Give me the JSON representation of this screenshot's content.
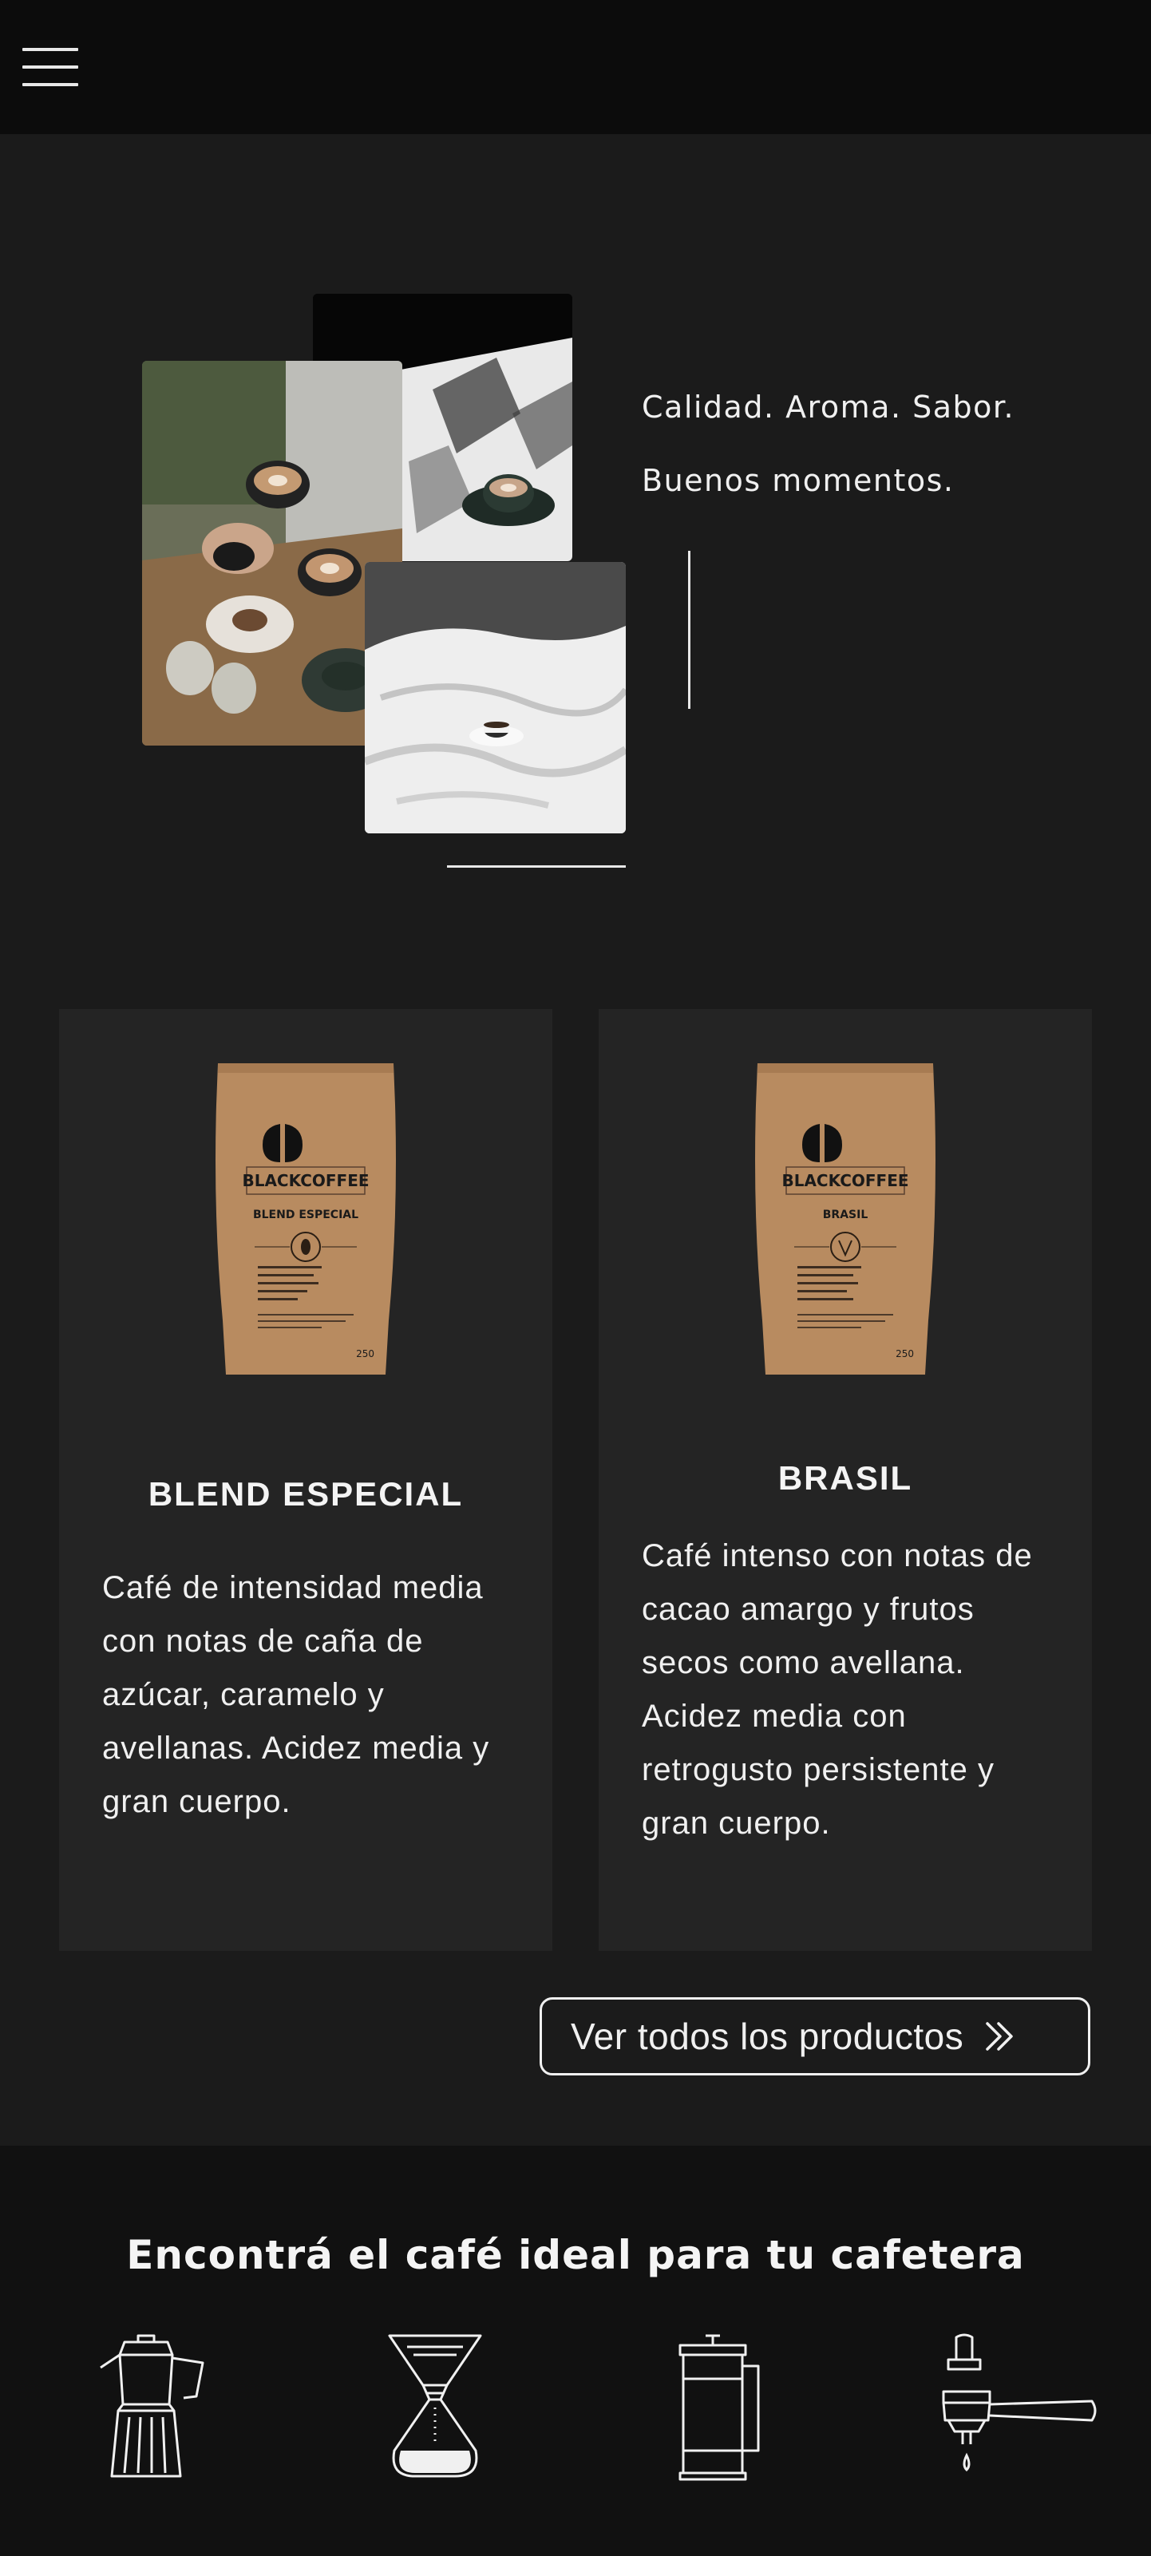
{
  "header": {
    "menu_icon": "hamburger-menu-icon"
  },
  "hero": {
    "tagline_1": "Calidad. Aroma. Sabor.",
    "tagline_2": "Buenos momentos."
  },
  "products": [
    {
      "brand": "BLACKCOFFEE",
      "bag_label": "BLEND ESPECIAL",
      "weight": "250",
      "title": "BLEND ESPECIAL",
      "description": "Café de intensidad media con notas de caña de azúcar, caramelo y avellanas. Acidez media y gran cuerpo."
    },
    {
      "brand": "BLACKCOFFEE",
      "bag_label": "BRASIL",
      "weight": "250",
      "title": "BRASIL",
      "description": "Café intenso con notas de cacao amargo y frutos secos como avellana. Acidez media con retrogusto persistente y gran cuerpo."
    }
  ],
  "cta": {
    "label": "Ver todos los productos",
    "icon": "double-chevron-right-icon"
  },
  "brewers": {
    "title": "Encontrá el café ideal para tu cafetera",
    "items": [
      "moka-pot-icon",
      "chemex-icon",
      "french-press-icon",
      "espresso-portafilter-icon"
    ]
  },
  "colors": {
    "background": "#1b1b1b",
    "header": "#0c0c0c",
    "card": "#242424",
    "bottom": "#111111",
    "kraft": "#b98d62",
    "text": "#f0f0f0"
  }
}
